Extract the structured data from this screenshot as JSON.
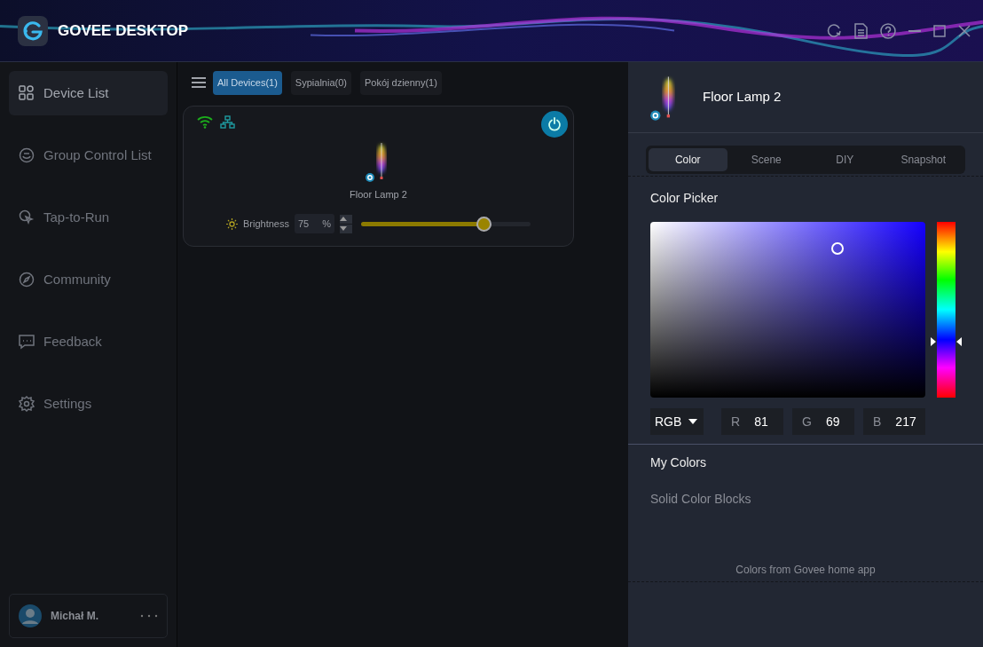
{
  "window": {
    "title": "GOVEE DESKTOP"
  },
  "sidebar": {
    "items": [
      {
        "label": "Device List",
        "selected": true
      },
      {
        "label": "Group Control List",
        "selected": false
      },
      {
        "label": "Tap-to-Run",
        "selected": false
      },
      {
        "label": "Community",
        "selected": false
      },
      {
        "label": "Feedback",
        "selected": false
      },
      {
        "label": "Settings",
        "selected": false
      }
    ],
    "user": {
      "name": "Michał M."
    }
  },
  "filters": [
    {
      "label": "All Devices(1)",
      "selected": true
    },
    {
      "label": "Sypialnia(0)",
      "selected": false
    },
    {
      "label": "Pokój dzienny(1)",
      "selected": false
    }
  ],
  "devices": [
    {
      "name": "Floor Lamp 2",
      "on": true,
      "brightness": {
        "label": "Brightness",
        "reading": "75",
        "unit": "%",
        "level": 0.75
      }
    }
  ],
  "detail": {
    "name": "Floor Lamp 2",
    "tabs": [
      {
        "label": "Color",
        "selected": true
      },
      {
        "label": "Scene",
        "selected": false
      },
      {
        "label": "DIY",
        "selected": false
      },
      {
        "label": "Snapshot",
        "selected": false
      }
    ],
    "picker": {
      "title": "Color Picker",
      "mode": "RGB",
      "rgb": [
        {
          "label": "R",
          "value": "81"
        },
        {
          "label": "G",
          "value": "69"
        },
        {
          "label": "B",
          "value": "217"
        }
      ]
    },
    "my_colors": {
      "title": "My Colors",
      "subtitle": "Solid Color Blocks",
      "footer": "Colors from Govee home app"
    }
  }
}
